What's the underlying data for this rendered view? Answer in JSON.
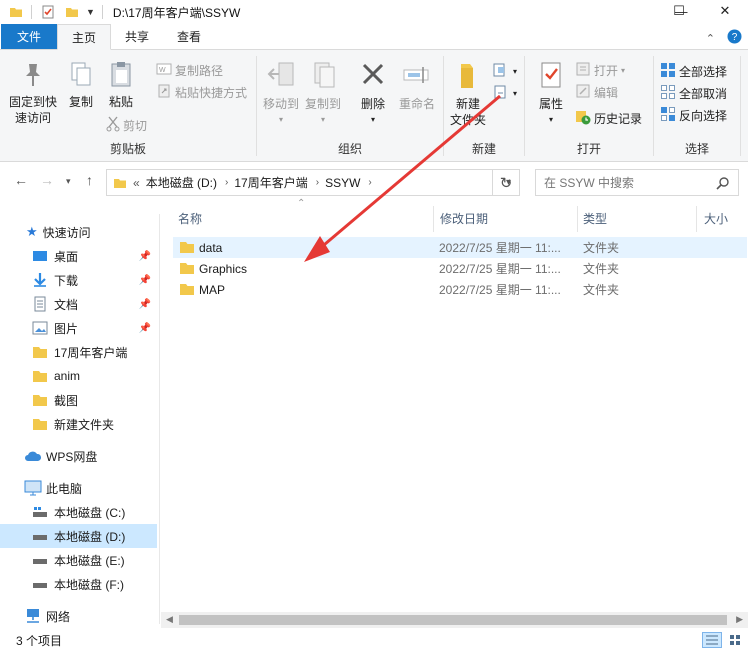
{
  "window": {
    "title": "D:\\17周年客户端\\SSYW",
    "minimize": "—",
    "maximize": "☐",
    "close": "✕"
  },
  "ribbon_tabs": [
    "文件",
    "主页",
    "共享",
    "查看"
  ],
  "ribbon": {
    "clipboard": {
      "pin_quick_access": "固定到快\n速访问",
      "copy": "复制",
      "paste": "粘贴",
      "copy_path": "复制路径",
      "paste_shortcut": "粘贴快捷方式",
      "cut": "剪切",
      "group_label": "剪贴板"
    },
    "organize": {
      "move_to": "移动到",
      "copy_to": "复制到",
      "delete": "删除",
      "rename": "重命名",
      "group_label": "组织"
    },
    "new": {
      "new_folder": "新建\n文件夹",
      "group_label": "新建"
    },
    "open": {
      "properties": "属性",
      "open": "打开",
      "edit": "编辑",
      "history": "历史记录",
      "group_label": "打开"
    },
    "select": {
      "select_all": "全部选择",
      "select_none": "全部取消",
      "invert": "反向选择",
      "group_label": "选择"
    }
  },
  "address": {
    "overflow": "«",
    "crumbs": [
      "本地磁盘 (D:)",
      "17周年客户端",
      "SSYW"
    ],
    "search_placeholder": "在 SSYW 中搜索"
  },
  "nav": {
    "quick_access": "快速访问",
    "quick_items": [
      "桌面",
      "下载",
      "文档",
      "图片",
      "17周年客户端",
      "anim",
      "截图",
      "新建文件夹"
    ],
    "wps": "WPS网盘",
    "this_pc": "此电脑",
    "drives": [
      "本地磁盘 (C:)",
      "本地磁盘 (D:)",
      "本地磁盘 (E:)",
      "本地磁盘 (F:)"
    ],
    "network": "网络"
  },
  "columns": {
    "name": "名称",
    "modified": "修改日期",
    "type": "类型",
    "size": "大小"
  },
  "files": [
    {
      "name": "data",
      "modified": "2022/7/25 星期一 11:...",
      "type": "文件夹"
    },
    {
      "name": "Graphics",
      "modified": "2022/7/25 星期一 11:...",
      "type": "文件夹"
    },
    {
      "name": "MAP",
      "modified": "2022/7/25 星期一 11:...",
      "type": "文件夹"
    }
  ],
  "status": {
    "count": "3 个项目"
  },
  "colors": {
    "accent": "#1979ca",
    "folder": "#f2c84b",
    "selection": "#cce8ff",
    "annotation_arrow": "#e53935"
  }
}
